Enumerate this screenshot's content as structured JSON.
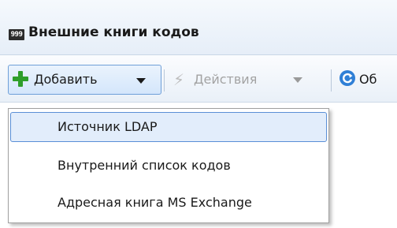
{
  "window": {
    "title_icon_text": "999",
    "title": "Внешние книги кодов"
  },
  "toolbar": {
    "add_label": "Добавить",
    "actions_label": "Действия",
    "refresh_label": "Об",
    "add_icon": "plus-icon",
    "actions_icon": "lightning-icon",
    "refresh_icon": "refresh-icon"
  },
  "menu": {
    "items": [
      {
        "label": "Источник LDAP",
        "selected": true
      },
      {
        "label": "Внутренний список кодов",
        "selected": false
      },
      {
        "label": "Адресная книга MS Exchange",
        "selected": false
      }
    ]
  },
  "colors": {
    "accent": "#5a8fd6",
    "plus": "#2e9e2a",
    "disabled": "#a3a3a3"
  }
}
